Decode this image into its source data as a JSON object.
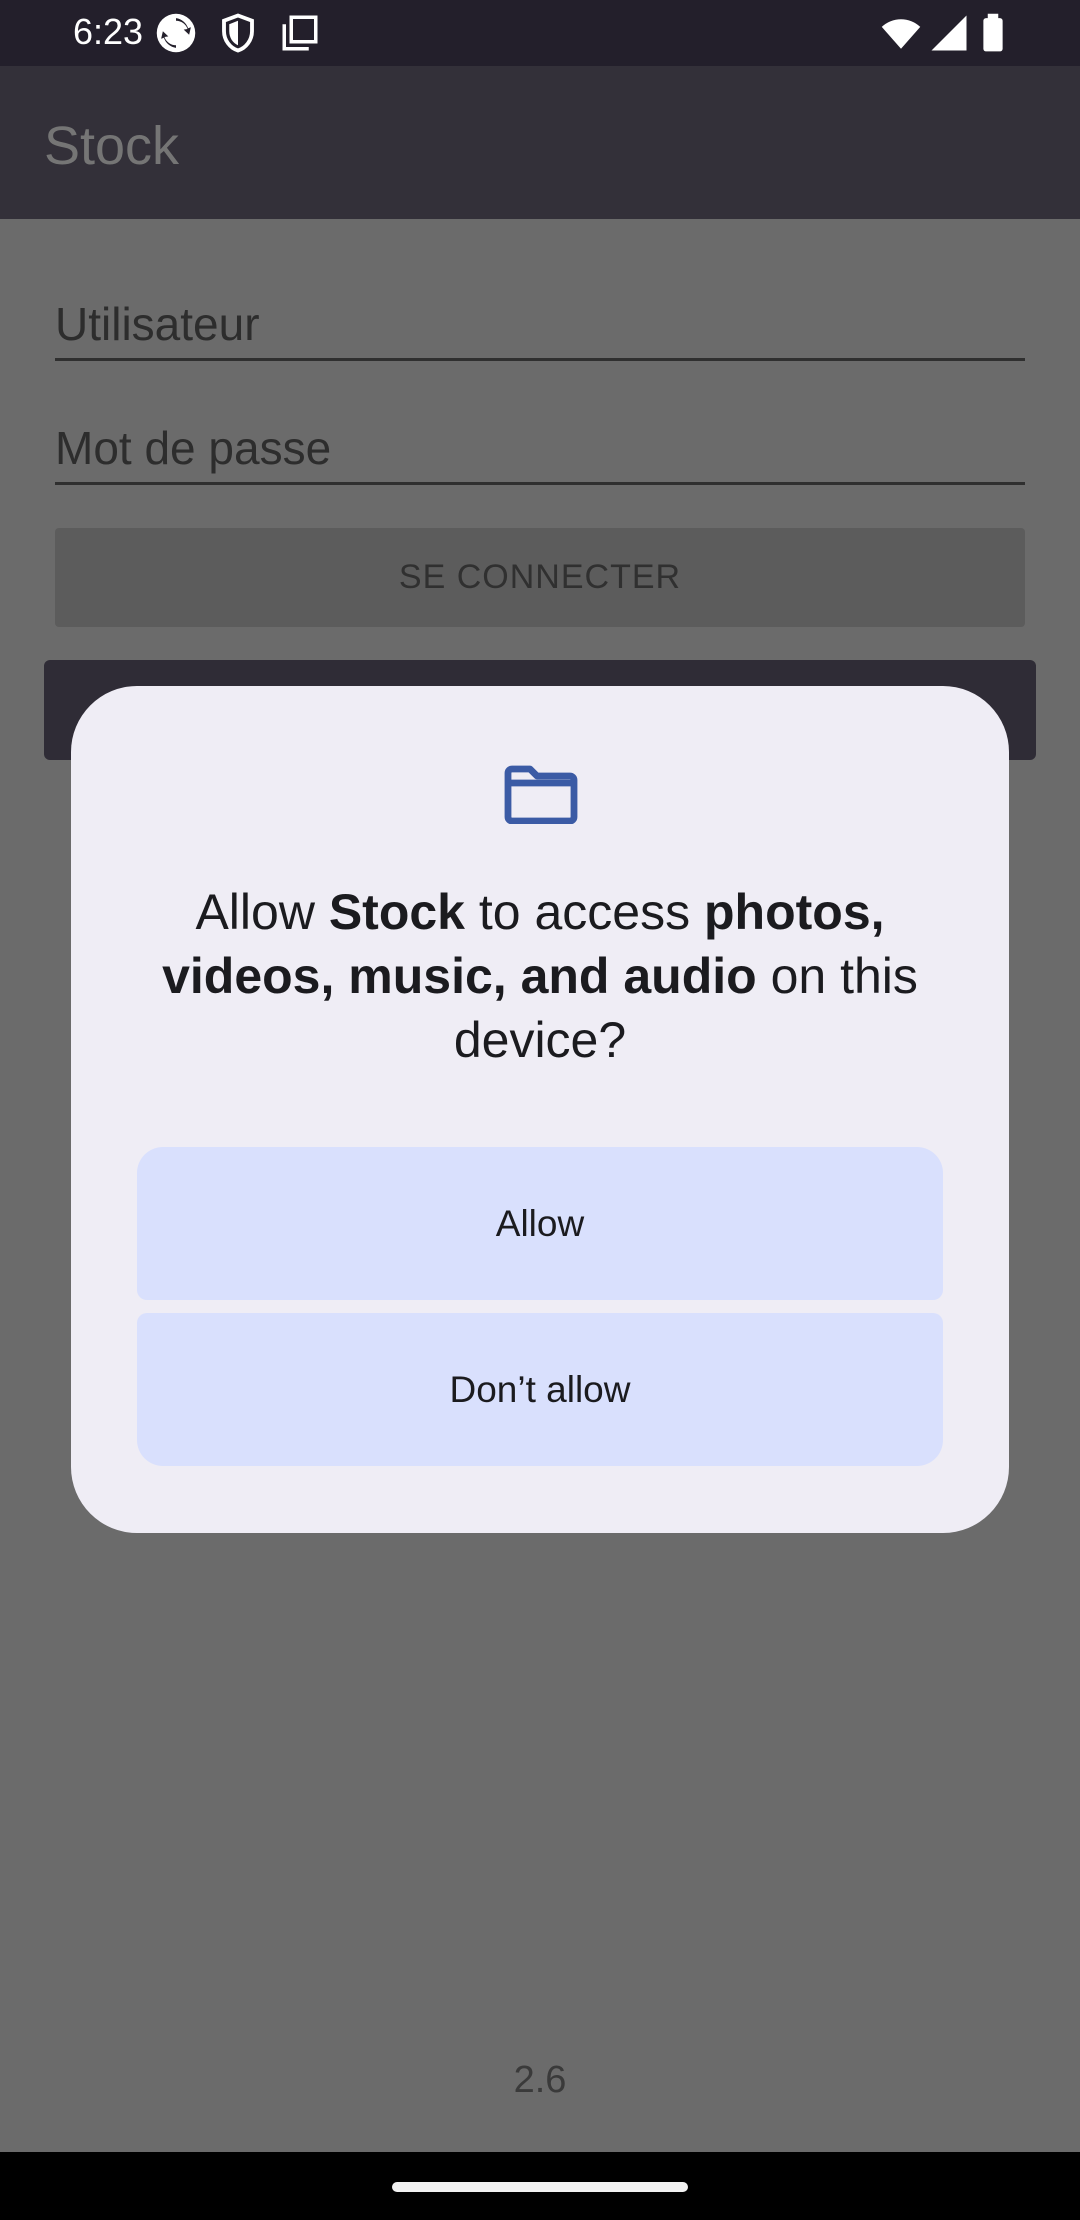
{
  "status_bar": {
    "time": "6:23",
    "left_icons": [
      "sync-icon",
      "shield-icon",
      "clipboard-icon"
    ],
    "right_icons": [
      "wifi-icon",
      "signal-icon",
      "battery-icon"
    ]
  },
  "app_bar": {
    "title": "Stock"
  },
  "login": {
    "username_placeholder": "Utilisateur",
    "password_placeholder": "Mot de passe",
    "login_button": "SE CONNECTER",
    "version": "2.6"
  },
  "dialog": {
    "icon": "folder-icon",
    "msg_part1": "Allow ",
    "msg_app": "Stock",
    "msg_part2": " to access ",
    "msg_media": "photos, videos, music, and audio",
    "msg_part3": " on this device?",
    "allow_label": "Allow",
    "deny_label": "Don’t allow"
  },
  "colors": {
    "status_bar": "#231f2b",
    "app_bar": "#333039",
    "scrim_background": "#6b6b6b",
    "dialog_background": "#efedf5",
    "dialog_button": "#d9e0fd",
    "folder_icon": "#3b5ba5"
  }
}
